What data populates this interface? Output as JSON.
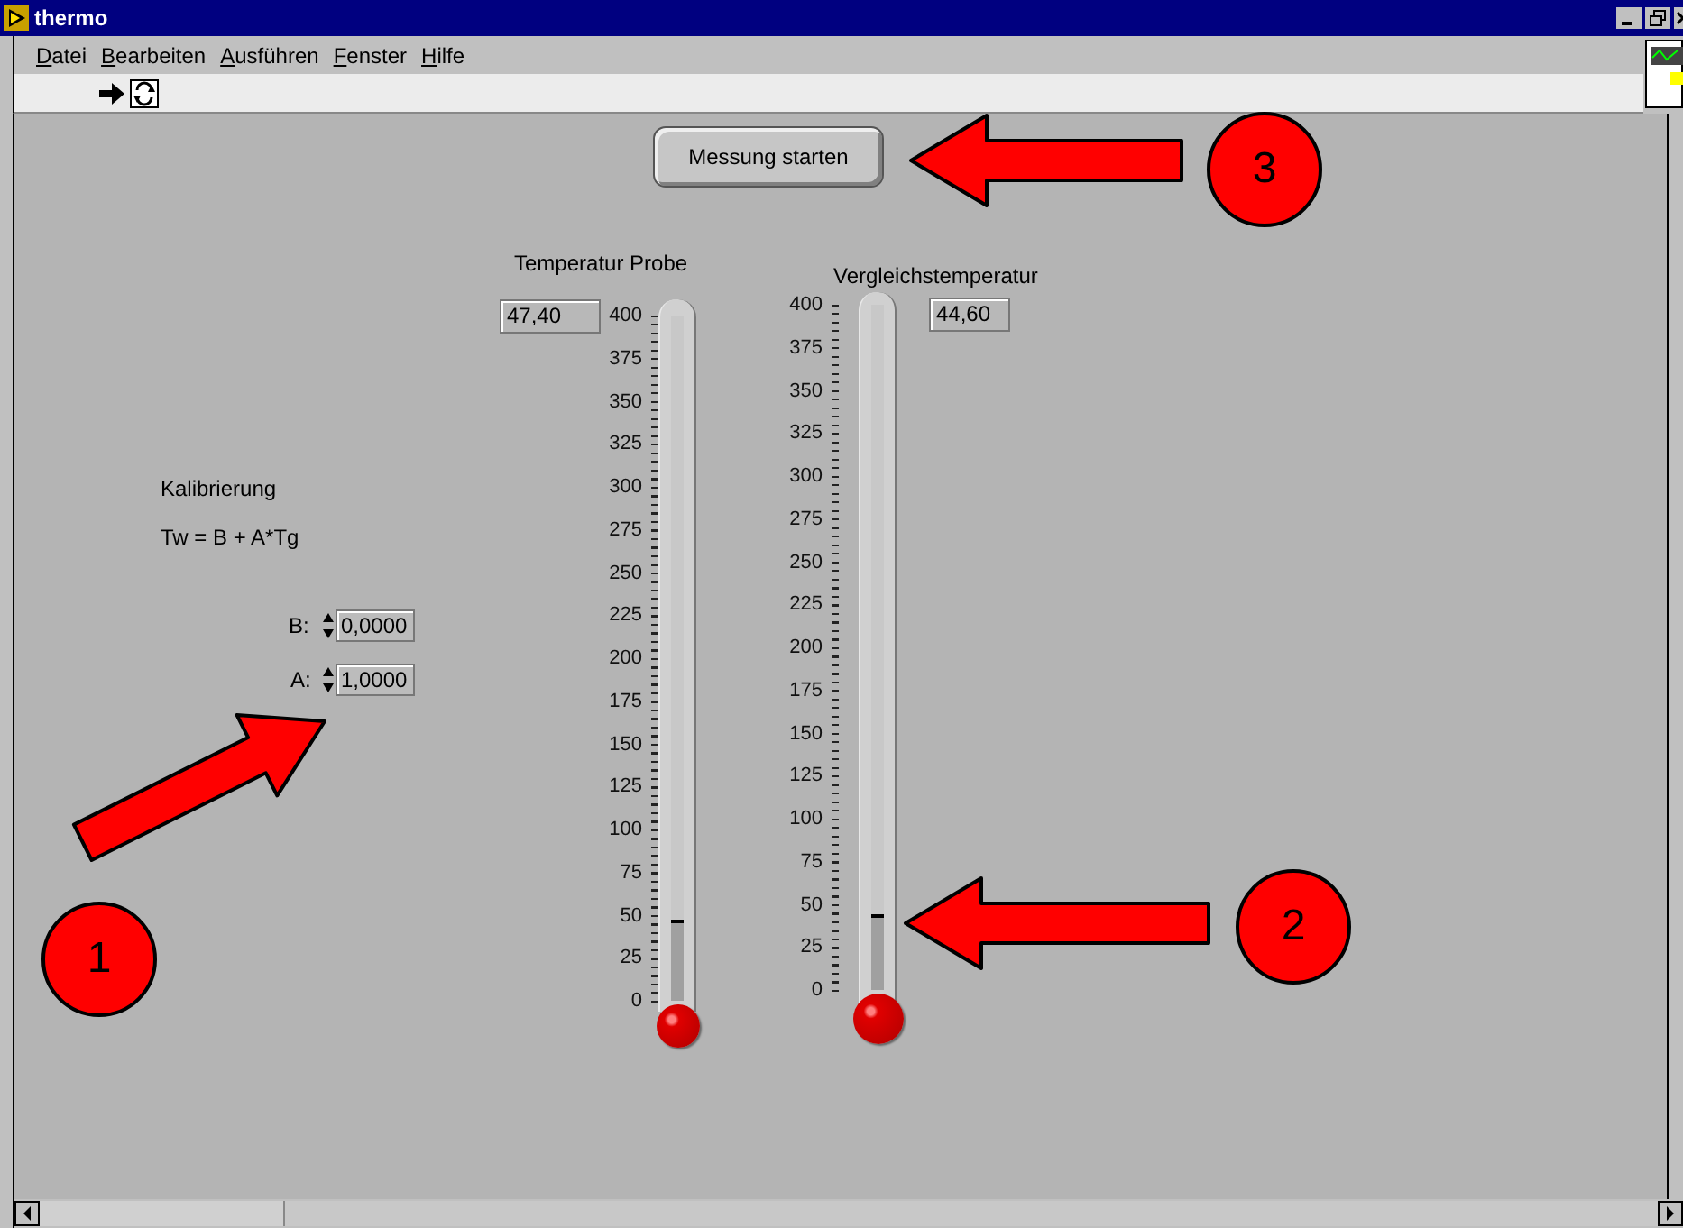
{
  "window": {
    "title": "thermo"
  },
  "menu": [
    {
      "label": "Datei"
    },
    {
      "label": "Bearbeiten"
    },
    {
      "label": "Ausführen"
    },
    {
      "label": "Fenster"
    },
    {
      "label": "Hilfe"
    }
  ],
  "start_button": {
    "label": "Messung starten"
  },
  "thermometers": [
    {
      "label": "Temperatur Probe",
      "reading": "47,40",
      "level": 0.1185,
      "scale": [
        "400",
        "375",
        "350",
        "325",
        "300",
        "275",
        "250",
        "225",
        "200",
        "175",
        "150",
        "125",
        "100",
        "75",
        "50",
        "25",
        "0"
      ]
    },
    {
      "label": "Vergleichstemperatur",
      "reading": "44,60",
      "level": 0.1115,
      "scale": [
        "400",
        "375",
        "350",
        "325",
        "300",
        "275",
        "250",
        "225",
        "200",
        "175",
        "150",
        "125",
        "100",
        "75",
        "50",
        "25",
        "0"
      ]
    }
  ],
  "calibration": {
    "title": "Kalibrierung",
    "formula": "Tw = B + A*Tg",
    "fields": [
      {
        "label": "B:",
        "value": "0,0000"
      },
      {
        "label": "A:",
        "value": "1,0000"
      }
    ]
  },
  "callouts": [
    {
      "number": "1"
    },
    {
      "number": "2"
    },
    {
      "number": "3"
    }
  ]
}
